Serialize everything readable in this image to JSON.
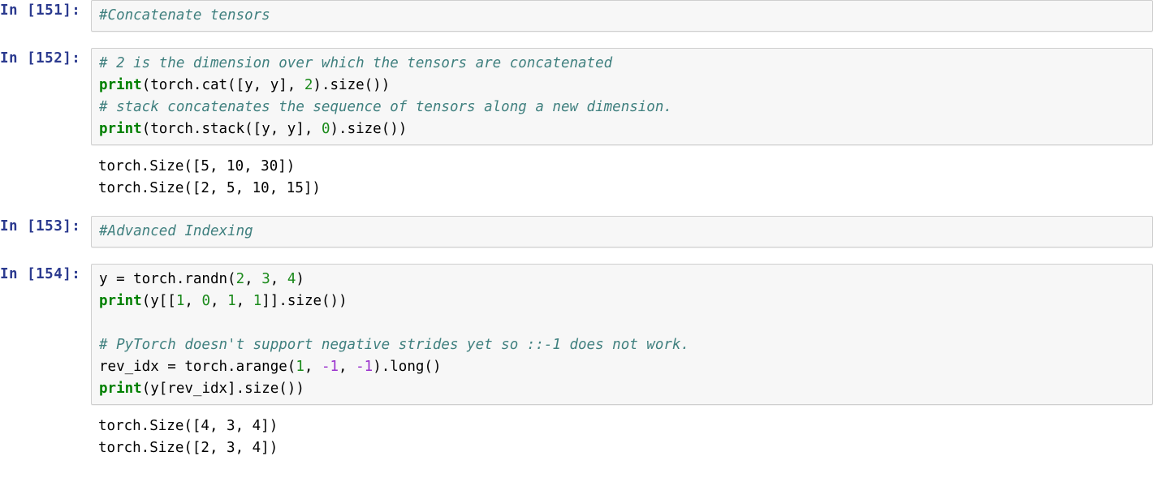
{
  "notebook": {
    "kernel_language": "python",
    "colors": {
      "cell_background": "#f7f7f7",
      "cell_border": "#cfcfcf",
      "prompt_in": "#2b3a8f",
      "comment": "#40807f",
      "builtin": "#008000",
      "number": "#1a8a1a",
      "negative_number": "#9a32cd",
      "page_background": "#ffffff"
    },
    "cells": [
      {
        "id": "cell-151",
        "type": "code",
        "prompt": "In [151]:",
        "execution_count": 151,
        "source_lines": [
          [
            {
              "t": "comment",
              "s": "#Concatenate tensors"
            }
          ]
        ],
        "outputs": []
      },
      {
        "id": "cell-152",
        "type": "code",
        "prompt": "In [152]:",
        "execution_count": 152,
        "source_lines": [
          [
            {
              "t": "comment",
              "s": "# 2 is the dimension over which the tensors are concatenated"
            }
          ],
          [
            {
              "t": "builtin",
              "s": "print"
            },
            {
              "t": "plain",
              "s": "(torch.cat([y, y], "
            },
            {
              "t": "number",
              "s": "2"
            },
            {
              "t": "plain",
              "s": ").size())"
            }
          ],
          [
            {
              "t": "comment",
              "s": "# stack concatenates the sequence of tensors along a new dimension."
            }
          ],
          [
            {
              "t": "builtin",
              "s": "print"
            },
            {
              "t": "plain",
              "s": "(torch.stack([y, y], "
            },
            {
              "t": "number",
              "s": "0"
            },
            {
              "t": "plain",
              "s": ").size())"
            }
          ]
        ],
        "outputs": [
          "torch.Size([5, 10, 30])",
          "torch.Size([2, 5, 10, 15])"
        ]
      },
      {
        "id": "cell-153",
        "type": "code",
        "prompt": "In [153]:",
        "execution_count": 153,
        "source_lines": [
          [
            {
              "t": "comment",
              "s": "#Advanced Indexing"
            }
          ]
        ],
        "outputs": []
      },
      {
        "id": "cell-154",
        "type": "code",
        "prompt": "In [154]:",
        "execution_count": 154,
        "source_lines": [
          [
            {
              "t": "plain",
              "s": "y = torch.randn("
            },
            {
              "t": "number",
              "s": "2"
            },
            {
              "t": "plain",
              "s": ", "
            },
            {
              "t": "number",
              "s": "3"
            },
            {
              "t": "plain",
              "s": ", "
            },
            {
              "t": "number",
              "s": "4"
            },
            {
              "t": "plain",
              "s": ")"
            }
          ],
          [
            {
              "t": "builtin",
              "s": "print"
            },
            {
              "t": "plain",
              "s": "(y[["
            },
            {
              "t": "number",
              "s": "1"
            },
            {
              "t": "plain",
              "s": ", "
            },
            {
              "t": "number",
              "s": "0"
            },
            {
              "t": "plain",
              "s": ", "
            },
            {
              "t": "number",
              "s": "1"
            },
            {
              "t": "plain",
              "s": ", "
            },
            {
              "t": "number",
              "s": "1"
            },
            {
              "t": "plain",
              "s": "]].size())"
            }
          ],
          [],
          [
            {
              "t": "comment",
              "s": "# PyTorch doesn't support negative strides yet so ::-1 does not work."
            }
          ],
          [
            {
              "t": "plain",
              "s": "rev_idx = torch.arange("
            },
            {
              "t": "number",
              "s": "1"
            },
            {
              "t": "plain",
              "s": ", "
            },
            {
              "t": "neg",
              "s": "-1"
            },
            {
              "t": "plain",
              "s": ", "
            },
            {
              "t": "neg",
              "s": "-1"
            },
            {
              "t": "plain",
              "s": ").long()"
            }
          ],
          [
            {
              "t": "builtin",
              "s": "print"
            },
            {
              "t": "plain",
              "s": "(y[rev_idx].size())"
            }
          ]
        ],
        "outputs": [
          "torch.Size([4, 3, 4])",
          "torch.Size([2, 3, 4])"
        ]
      }
    ]
  }
}
